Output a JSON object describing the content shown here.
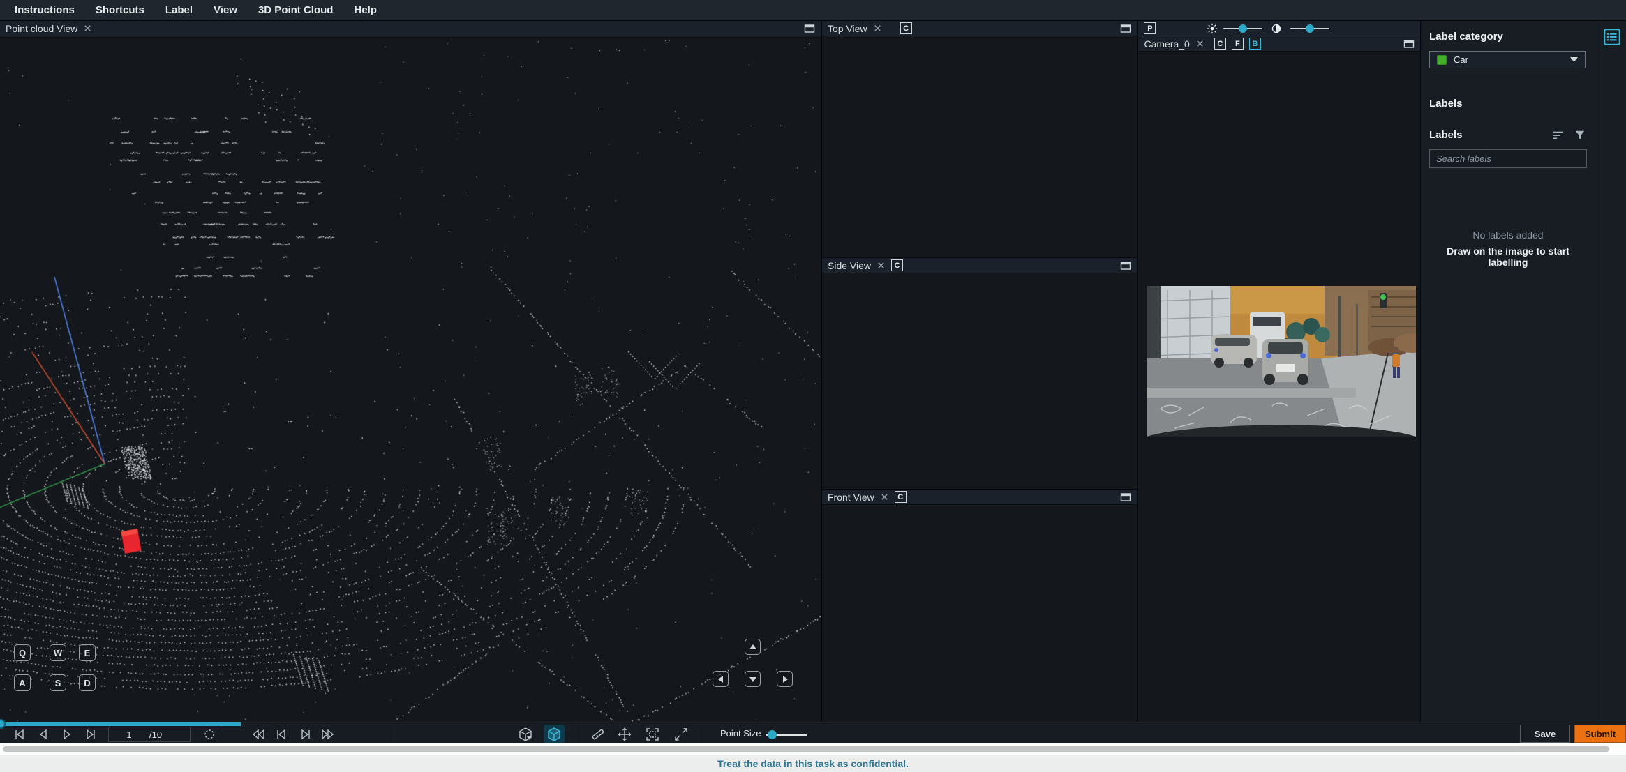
{
  "menu": {
    "items": [
      "Instructions",
      "Shortcuts",
      "Label",
      "View",
      "3D Point Cloud",
      "Help"
    ]
  },
  "panels": {
    "point_cloud": {
      "title": "Point cloud View"
    },
    "top_view": {
      "title": "Top View",
      "camera_btn": "C"
    },
    "side_view": {
      "title": "Side View",
      "camera_btn": "C"
    },
    "front_view": {
      "title": "Front View",
      "camera_btn": "C"
    },
    "camera": {
      "title": "Camera_0",
      "projection_btn": "P",
      "view_btns": {
        "c": "C",
        "f": "F",
        "b": "B"
      }
    }
  },
  "pc": {
    "keys": {
      "q": "Q",
      "w": "W",
      "e": "E",
      "a": "A",
      "s": "S",
      "d": "D"
    }
  },
  "sidebar": {
    "label_category_title": "Label category",
    "category": {
      "name": "Car"
    },
    "labels_title": "Labels",
    "labels_list_title": "Labels",
    "search_placeholder": "Search labels",
    "empty_line1": "No labels added",
    "empty_line2": "Draw on the image to start labelling"
  },
  "toolbar": {
    "frame_current": "1",
    "frame_total": "/10",
    "point_size_label": "Point Size",
    "save_label": "Save",
    "submit_label": "Submit"
  },
  "footer": {
    "message": "Treat the data in this task as confidential."
  },
  "colors": {
    "accent": "#2ea8c9",
    "submit_orange": "#ec7211",
    "category_green": "#43b02a",
    "cuboid_red": "#e8262d"
  }
}
